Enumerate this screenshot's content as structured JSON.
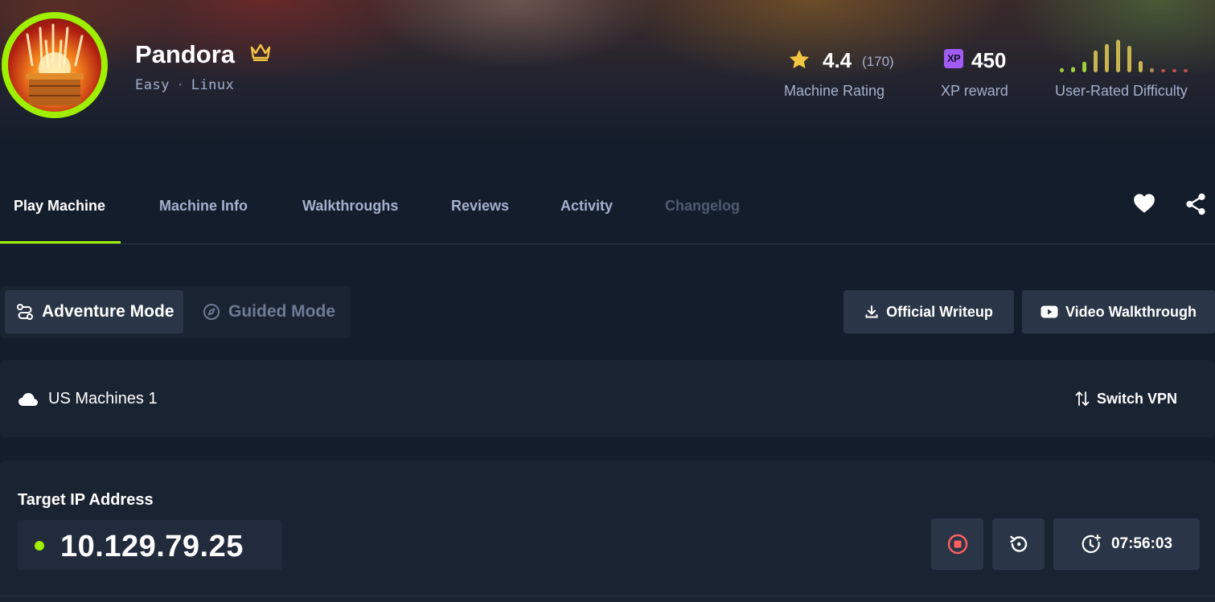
{
  "machine": {
    "name": "Pandora",
    "difficulty": "Easy",
    "separator": "·",
    "os": "Linux"
  },
  "stats": {
    "rating_value": "4.4",
    "rating_count": "(170)",
    "rating_label": "Machine Rating",
    "xp_badge": "XP",
    "xp_value": "450",
    "xp_label": "XP reward",
    "difficulty_label": "User-Rated Difficulty",
    "difficulty_bars": [
      0.12,
      0.15,
      0.3,
      0.62,
      0.8,
      0.92,
      0.75,
      0.32,
      0.12,
      0.06,
      0.06,
      0.06
    ]
  },
  "tabs": [
    {
      "label": "Play Machine",
      "state": "active"
    },
    {
      "label": "Machine Info",
      "state": "normal"
    },
    {
      "label": "Walkthroughs",
      "state": "normal"
    },
    {
      "label": "Reviews",
      "state": "normal"
    },
    {
      "label": "Activity",
      "state": "normal"
    },
    {
      "label": "Changelog",
      "state": "disabled"
    }
  ],
  "modes": {
    "adventure": "Adventure Mode",
    "guided": "Guided Mode",
    "selected": "Adventure Mode"
  },
  "actions": {
    "writeup": "Official Writeup",
    "video": "Video Walkthrough"
  },
  "vpn": {
    "server": "US Machines 1",
    "switch_label": "Switch VPN"
  },
  "target": {
    "label": "Target IP Address",
    "ip": "10.129.79.25",
    "timer": "07:56:03"
  },
  "colors": {
    "accent": "#9fef00",
    "background": "#141d2b",
    "panel": "#1a2332",
    "button": "#2a3548",
    "star": "#f5c542",
    "xp": "#a15cf5",
    "stop": "#ff5f5f"
  },
  "icons": {
    "crown": "crown-icon",
    "star": "star-icon",
    "heart": "heart-icon",
    "share": "share-icon",
    "route": "route-icon",
    "compass": "compass-icon",
    "download": "download-icon",
    "youtube": "youtube-icon",
    "cloud": "cloud-icon",
    "swap": "swap-arrows-icon",
    "stop": "stop-icon",
    "reset": "reset-icon",
    "timer": "timer-add-icon"
  }
}
